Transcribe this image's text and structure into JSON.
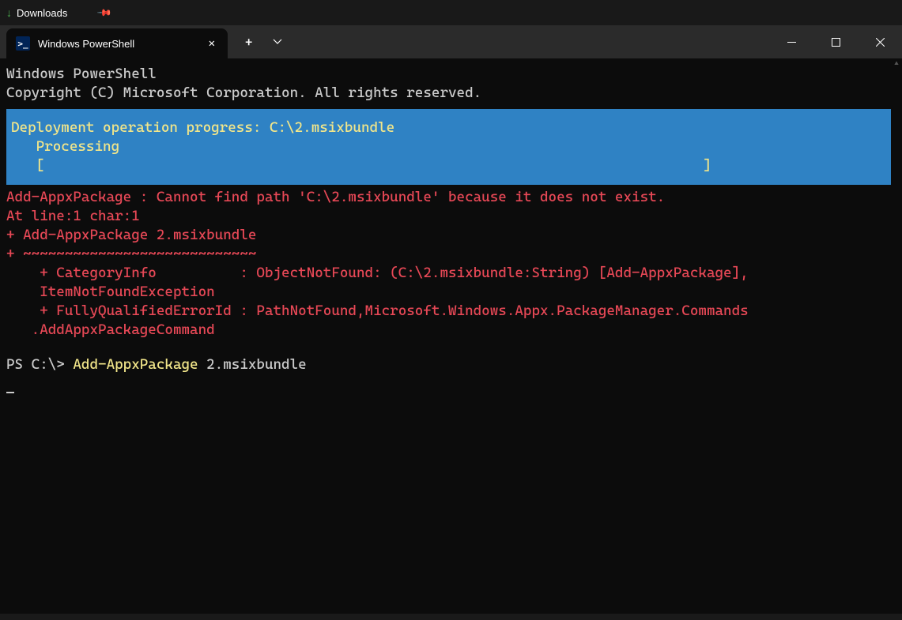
{
  "taskbar": {
    "downloads_label": "Downloads"
  },
  "tab": {
    "title": "Windows PowerShell"
  },
  "window_controls": {
    "minimize": "—",
    "maximize": "☐",
    "close": "✕"
  },
  "terminal": {
    "header_line1": "Windows PowerShell",
    "header_line2": "Copyright (C) Microsoft Corporation. All rights reserved.",
    "progress": {
      "line1": "Deployment operation progress: C:\\2.msixbundle",
      "line2": "   Processing",
      "line3": "   [                                                                               ]"
    },
    "error": {
      "line1": "Add-AppxPackage : Cannot find path 'C:\\2.msixbundle' because it does not exist.",
      "line2": "At line:1 char:1",
      "line3": "+ Add-AppxPackage 2.msixbundle",
      "line4": "+ ~~~~~~~~~~~~~~~~~~~~~~~~~~~~",
      "line5": "    + CategoryInfo          : ObjectNotFound: (C:\\2.msixbundle:String) [Add-AppxPackage],",
      "line6": "    ItemNotFoundException",
      "line7": "    + FullyQualifiedErrorId : PathNotFound,Microsoft.Windows.Appx.PackageManager.Commands",
      "line8": "   .AddAppxPackageCommand"
    },
    "prompt": {
      "prefix": "PS C:\\> ",
      "command": "Add-AppxPackage",
      "argument": " 2.msixbundle"
    }
  }
}
